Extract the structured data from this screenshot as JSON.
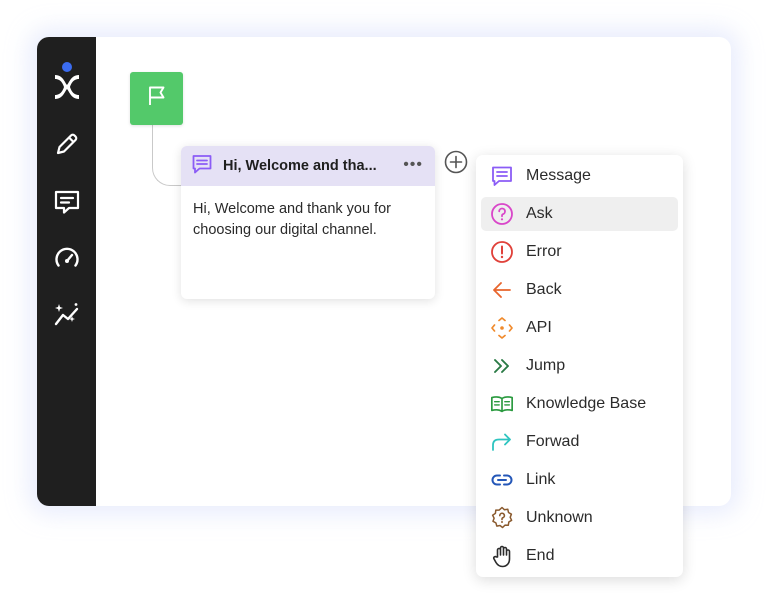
{
  "sidebar": {
    "items": [
      {
        "icon": "pencil-icon"
      },
      {
        "icon": "chat-message-icon"
      },
      {
        "icon": "speedometer-icon"
      },
      {
        "icon": "analytics-sparkle-icon"
      }
    ]
  },
  "flow": {
    "start_node": {
      "icon": "flag-icon",
      "color": "#53c96a"
    },
    "message_node": {
      "title": "Hi, Welcome and tha...",
      "body": "Hi, Welcome and thank you for choosing our digital channel.",
      "more": "•••",
      "header_color": "#e5e1f5"
    }
  },
  "menu": {
    "items": [
      {
        "label": "Message",
        "icon": "message-icon",
        "color": "#8b5cf6",
        "active": false
      },
      {
        "label": "Ask",
        "icon": "question-icon",
        "color": "#d946c9",
        "active": true
      },
      {
        "label": "Error",
        "icon": "error-icon",
        "color": "#e0413a",
        "active": false
      },
      {
        "label": "Back",
        "icon": "arrow-left-icon",
        "color": "#e8652d",
        "active": false
      },
      {
        "label": "API",
        "icon": "api-icon",
        "color": "#f08a2c",
        "active": false
      },
      {
        "label": "Jump",
        "icon": "double-chevron-icon",
        "color": "#2a7a45",
        "active": false
      },
      {
        "label": "Knowledge Base",
        "icon": "book-icon",
        "color": "#2a9a3f",
        "active": false
      },
      {
        "label": "Forwad",
        "icon": "forward-arrow-icon",
        "color": "#2ec4c0",
        "active": false
      },
      {
        "label": "Link",
        "icon": "link-icon",
        "color": "#2457b8",
        "active": false
      },
      {
        "label": "Unknown",
        "icon": "unknown-icon",
        "color": "#8a5a2e",
        "active": false
      },
      {
        "label": "End",
        "icon": "hand-icon",
        "color": "#2b2b2b",
        "active": false
      }
    ]
  }
}
